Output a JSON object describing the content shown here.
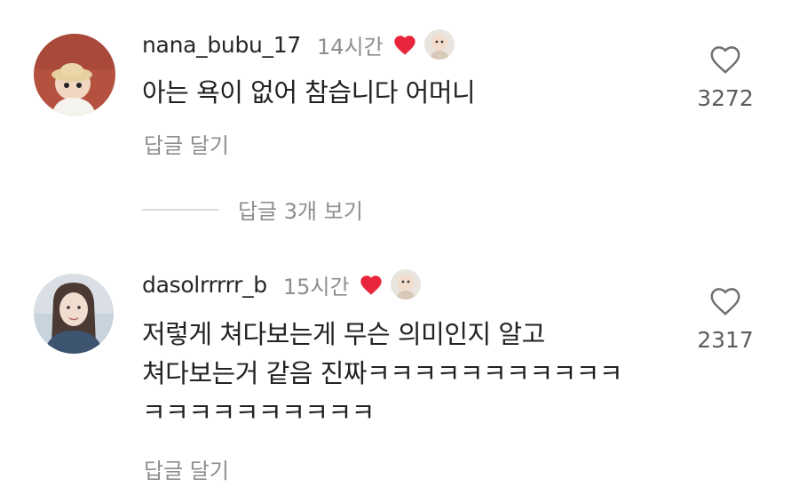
{
  "comments": [
    {
      "username": "nana_bubu_17",
      "time": "14시간",
      "text_lines": [
        "아는 욕이 없어 참습니다 어머니"
      ],
      "reply_label": "답글 달기",
      "likes": "3272",
      "view_replies": "답글 3개 보기"
    },
    {
      "username": "dasolrrrrr_b",
      "time": "15시간",
      "text_lines": [
        "저렇게 쳐다보는게 무슨 의미인지 알고",
        "쳐다보는거 같음 진짜ㅋㅋㅋㅋㅋㅋㅋㅋㅋㅋㅋ",
        "ㅋㅋㅋㅋㅋㅋㅋㅋㅋㅋ"
      ],
      "reply_label": "답글 달기",
      "likes": "2317"
    }
  ],
  "colors": {
    "liked_heart": "#e8253b",
    "meta_gray": "#8e8e8e",
    "text": "#222222"
  },
  "icons": {
    "creator_liked": "heart-filled-icon",
    "like": "heart-outline-icon"
  }
}
